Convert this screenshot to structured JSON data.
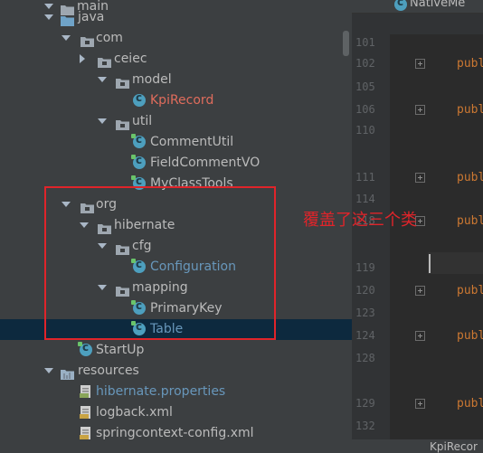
{
  "project_tree": {
    "rows": [
      {
        "label": "main",
        "icon": "folder-icon",
        "color": "#bbbbbb"
      },
      {
        "label": "java",
        "icon": "source-folder-icon",
        "color": "#bbbbbb"
      },
      {
        "label": "com",
        "icon": "package-icon",
        "color": "#bbbbbb"
      },
      {
        "label": "ceiec",
        "icon": "package-icon",
        "color": "#bbbbbb"
      },
      {
        "label": "model",
        "icon": "package-icon",
        "color": "#bbbbbb"
      },
      {
        "label": "KpiRecord",
        "icon": "class-icon",
        "color": "#e06c5c"
      },
      {
        "label": "util",
        "icon": "package-icon",
        "color": "#bbbbbb"
      },
      {
        "label": "CommentUtil",
        "icon": "class-icon",
        "color": "#bbbbbb"
      },
      {
        "label": "FieldCommentVO",
        "icon": "class-icon",
        "color": "#bbbbbb"
      },
      {
        "label": "MyClassTools",
        "icon": "class-icon",
        "color": "#bbbbbb"
      },
      {
        "label": "org",
        "icon": "package-icon",
        "color": "#bbbbbb"
      },
      {
        "label": "hibernate",
        "icon": "package-icon",
        "color": "#bbbbbb"
      },
      {
        "label": "cfg",
        "icon": "package-icon",
        "color": "#bbbbbb"
      },
      {
        "label": "Configuration",
        "icon": "class-icon",
        "color": "#6897bb"
      },
      {
        "label": "mapping",
        "icon": "package-icon",
        "color": "#bbbbbb"
      },
      {
        "label": "PrimaryKey",
        "icon": "class-icon",
        "color": "#bbbbbb"
      },
      {
        "label": "Table",
        "icon": "class-icon",
        "color": "#6897bb"
      },
      {
        "label": "StartUp",
        "icon": "class-icon",
        "color": "#bbbbbb"
      },
      {
        "label": "resources",
        "icon": "resources-folder-icon",
        "color": "#bbbbbb"
      },
      {
        "label": "hibernate.properties",
        "icon": "properties-file-icon",
        "color": "#6897bb"
      },
      {
        "label": "logback.xml",
        "icon": "xml-file-icon",
        "color": "#bbbbbb"
      },
      {
        "label": "springcontext-config.xml",
        "icon": "xml-file-icon",
        "color": "#bbbbbb"
      }
    ]
  },
  "editor": {
    "tab_label": "NativeMe",
    "bottom_tab_label": "KpiRecor",
    "line_numbers": [
      "101",
      "102",
      "105",
      "106",
      "110",
      "111",
      "114",
      "118",
      "119",
      "120",
      "123",
      "124",
      "128",
      "129",
      "132"
    ],
    "code_lines": [
      "publ",
      "publ",
      "publ",
      "publ",
      "publ",
      "publ",
      "publ"
    ]
  },
  "annotation": {
    "text": "覆盖了这三个类",
    "color": "#e0242a"
  },
  "colors": {
    "tree_bg": "#3c3f41",
    "editor_bg": "#2b2b2b",
    "selection_bg": "#0d293e",
    "keyword": "#cc7832"
  }
}
